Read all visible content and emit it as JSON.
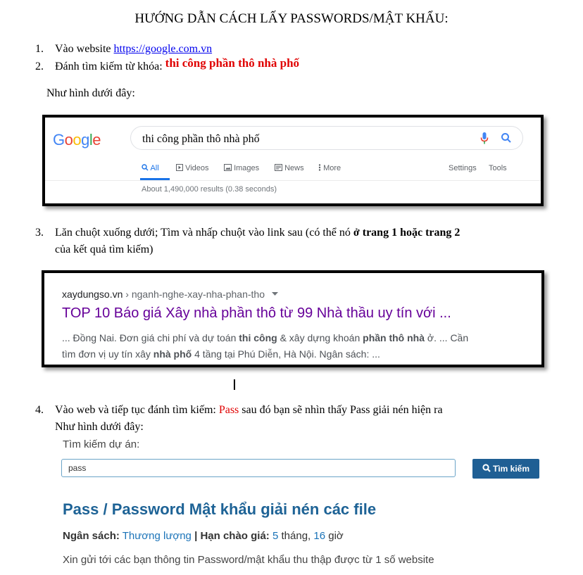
{
  "title": "HƯỚNG DẪN CÁCH LẤY PASSWORDS/MẬT  KHẨU:",
  "step1": {
    "num": "1.",
    "text": "Vào website ",
    "link": "https://google.com.vn"
  },
  "step2": {
    "num": "2.",
    "text": "Đánh tìm kiếm từ khóa: ",
    "keyword": "thi công phần thô nhà phố"
  },
  "as_shown": "Như hình dưới đây:",
  "google": {
    "logo": "Google",
    "query": "thi công phần thô nhà phố",
    "tabs": [
      "All",
      "Videos",
      "Images",
      "News",
      "More"
    ],
    "settings": "Settings",
    "tools": "Tools",
    "results": "About 1,490,000 results (0.38 seconds)"
  },
  "step3": {
    "num": "3.",
    "line1_a": "Lăn chuột xuống dưới; Tìm và nhấp chuột vào link sau (có thể nó ",
    "line1_b": "ở trang 1 hoặc trang 2",
    "line2": "của kết quả tìm kiếm)"
  },
  "result": {
    "domain": "xaydungso.vn",
    "path": " › nganh-nghe-xay-nha-phan-tho",
    "title": "TOP 10 Báo giá Xây nhà phần thô từ 99 Nhà thầu uy tín với ...",
    "snippet1": [
      {
        "t": "... Đồng Nai. Đơn giá chi phí và dự toán ",
        "b": false
      },
      {
        "t": "thi công",
        "b": true
      },
      {
        "t": " & xây dựng khoán ",
        "b": false
      },
      {
        "t": "phần thô nhà",
        "b": true
      },
      {
        "t": " ở. ... Cần",
        "b": false
      }
    ],
    "snippet2": [
      {
        "t": "tìm đơn vị uy tín xây ",
        "b": false
      },
      {
        "t": "nhà phố",
        "b": true
      },
      {
        "t": " 4 tầng tại Phú Diễn, Hà Nội. Ngân sách: ...",
        "b": false
      }
    ]
  },
  "step4": {
    "num": "4.",
    "text_a": "Vào web và tiếp tục đánh tìm kiếm: ",
    "keyword": "Pass",
    "text_b": " sau đó bạn sẽ nhìn thấy Pass giải nén hiện ra",
    "line2": "Như hình dưới đây:"
  },
  "project_search": {
    "label": "Tìm kiếm dự án:",
    "input_value": "pass",
    "button_label": "Tìm kiếm",
    "result_title": "Pass / Password Mật khẩu giải nén các file",
    "budget_label": "Ngân sách:",
    "budget_value": "Thương lượng",
    "sep": " | ",
    "deadline_label": "Hạn chào giá:",
    "months": "5",
    "months_unit": " tháng, ",
    "hours": "16",
    "hours_unit": " giờ",
    "description": "Xin gửi tới các bạn thông tin Password/mật khẩu thu thập được từ 1 số website"
  },
  "colors": {
    "link": "#0000ee",
    "keyword_red": "#e00000",
    "result_title": "#660099",
    "brand_blue": "#1e6396",
    "button": "#1f5f94"
  }
}
